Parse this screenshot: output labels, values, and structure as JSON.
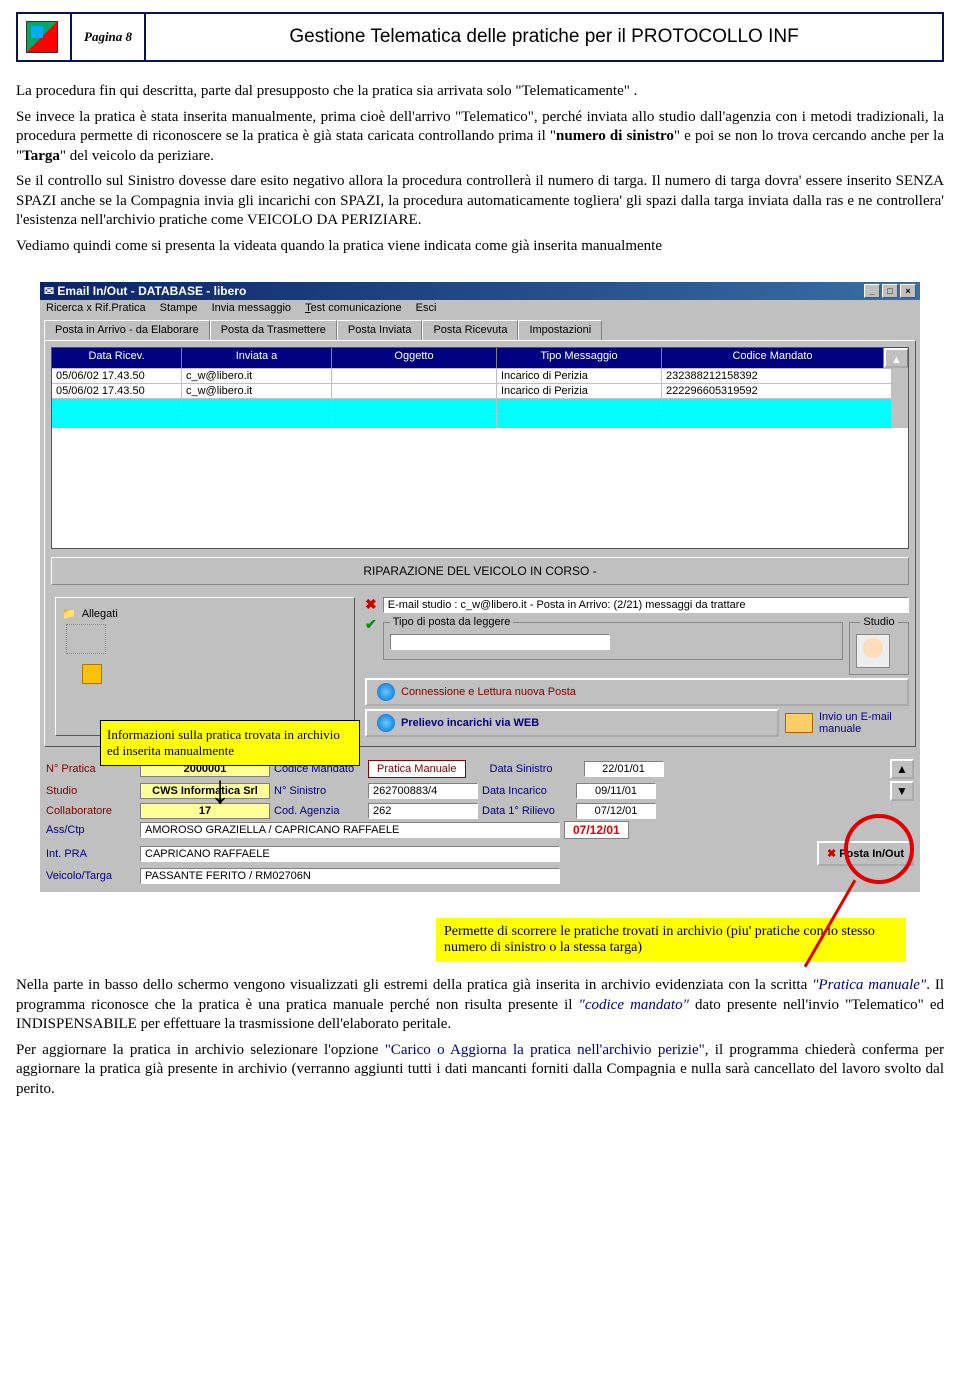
{
  "header": {
    "page": "Pagina 8",
    "title": "Gestione Telematica delle pratiche per il PROTOCOLLO INF"
  },
  "para1": "La procedura fin qui descritta, parte dal presupposto che la pratica sia arrivata solo \"Telematicamente\" .",
  "para2a": "Se invece la pratica è stata inserita manualmente, prima cioè dell'arrivo \"Telematico\", perché inviata allo studio dall'agenzia con i metodi tradizionali, la procedura permette di riconoscere se la pratica è già stata caricata controllando prima il \"",
  "para2b": "numero di sinistro",
  "para2c": "\" e poi se non lo trova cercando anche per la \"",
  "para2d": "Targa",
  "para2e": "\" del veicolo da periziare.",
  "para3": "Se il controllo sul Sinistro dovesse dare esito negativo allora la procedura controllerà il numero di targa. Il numero di targa dovra' essere inserito SENZA SPAZI anche se la Compagnia invia gli incarichi con SPAZI, la procedura automaticamente togliera' gli spazi dalla targa inviata dalla ras e ne controllera' l'esistenza nell'archivio pratiche come VEICOLO DA PERIZIARE.",
  "para4": "Vediamo quindi come si presenta la videata quando la pratica viene indicata come già inserita manualmente",
  "app": {
    "title": "Email In/Out - DATABASE - libero",
    "menu": [
      "Ricerca x Rif.Pratica",
      "Stampe",
      "Invia messaggio",
      "Test comunicazione",
      "Esci"
    ],
    "tabs": [
      "Posta in Arrivo - da Elaborare",
      "Posta da Trasmettere",
      "Posta Inviata",
      "Posta Ricevuta",
      "Impostazioni"
    ],
    "cols": [
      "Data Ricev.",
      "Inviata a",
      "Oggetto",
      "Tipo Messaggio",
      "Codice Mandato"
    ],
    "rows": [
      {
        "d": "05/06/02 17.43.50",
        "a": "c_w@libero.it",
        "o": "",
        "t": "Incarico di Perizia",
        "c": "232388212158392"
      },
      {
        "d": "05/06/02 17.43.50",
        "a": "c_w@libero.it",
        "o": "",
        "t": "Incarico di Perizia",
        "c": "222296605319592"
      }
    ],
    "banner": "RIPARAZIONE DEL VEICOLO IN CORSO -",
    "allegati": "Allegati",
    "emailinfo": "E-mail studio : c_w@libero.it - Posta in Arrivo: (2/21) messaggi da trattare",
    "tipoposta": "Tipo di posta da leggere",
    "studio_lbl": "Studio",
    "btn_conn": "Connessione e Lettura nuova Posta",
    "btn_web": "Prelievo incarichi via WEB",
    "btn_inv": "Invio un E-mail manuale",
    "detail": {
      "npratica_l": "N° Pratica",
      "npratica": "2000001",
      "codman_l": "Codice Mandato",
      "pman": "Pratica Manuale",
      "dsin_l": "Data Sinistro",
      "dsin": "22/01/01",
      "studio_l": "Studio",
      "studio": "CWS Informatica Srl",
      "nsin_l": "N° Sinistro",
      "nsin": "262700883/4",
      "dinc_l": "Data Incarico",
      "dinc": "09/11/01",
      "collab_l": "Collaboratore",
      "collab": "17",
      "cag_l": "Cod. Agenzia",
      "cag": "262",
      "dril_l": "Data 1° Rilievo",
      "dril": "07/12/01",
      "ass_l": "Ass/Ctp",
      "ass": "AMOROSO GRAZIELLA / CAPRICANO RAFFAELE",
      "d2": "07/12/01",
      "int_l": "Int. PRA",
      "int": "CAPRICANO RAFFAELE",
      "vt_l": "Veicolo/Targa",
      "vt": "PASSANTE FERITO / RM02706N",
      "posta": "Posta In/Out"
    }
  },
  "callout1": "Informazioni sulla pratica trovata in archivio ed inserita manualmente",
  "callout2": "Permette di scorrere le pratiche trovati in archivio (piu' pratiche con lo stesso numero di sinistro o la stessa targa)",
  "para5a": "Nella parte in basso dello schermo vengono visualizzati gli estremi della pratica già inserita in archivio evidenziata con la scritta ",
  "para5b": "\"Pratica manuale\"",
  "para5c": ". Il programma riconosce che la pratica è una pratica manuale perché non risulta presente il ",
  "para5d": "\"codice mandato\"",
  "para5e": " dato presente nell'invio \"Telematico\" ed INDISPENSABILE per effettuare la trasmissione dell'elaborato peritale.",
  "para6a": "Per aggiornare la pratica in archivio selezionare l'opzione ",
  "para6b": "\"Carico o Aggiorna la pratica nell'archivio perizie\"",
  "para6c": ", il programma chiederà conferma per aggiornare la pratica già presente in archivio (verranno aggiunti tutti i dati mancanti forniti dalla Compagnia e nulla sarà cancellato del lavoro svolto dal perito."
}
